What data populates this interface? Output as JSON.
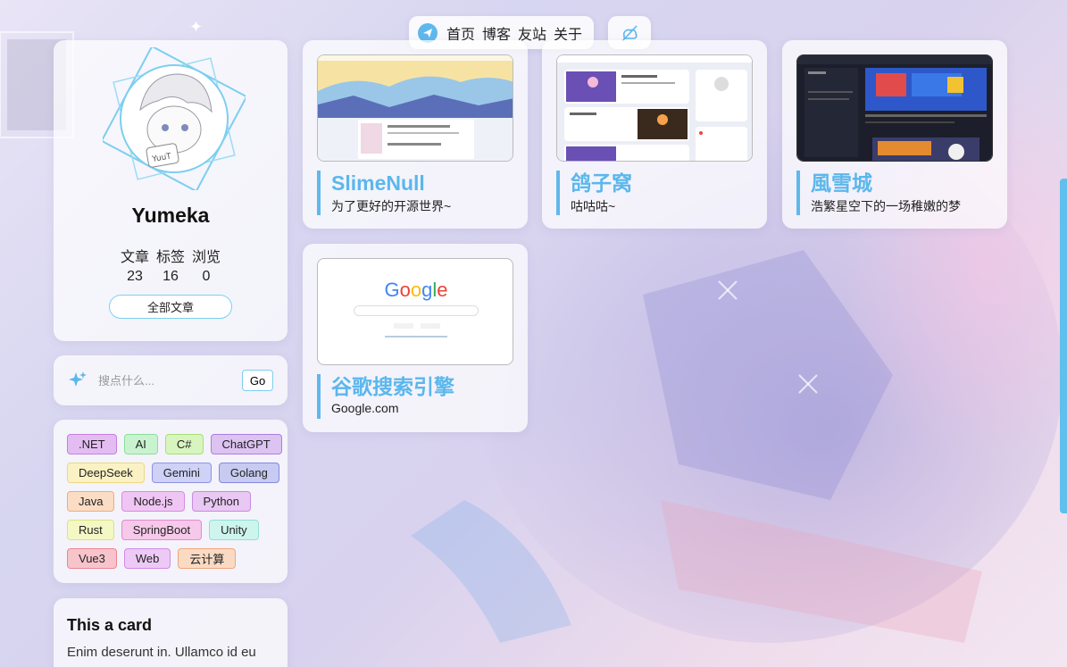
{
  "nav": {
    "links": [
      "首页",
      "博客",
      "友站",
      "关于"
    ]
  },
  "profile": {
    "name": "Yumeka",
    "stats": [
      {
        "label": "文章",
        "value": "23"
      },
      {
        "label": "标签",
        "value": "16"
      },
      {
        "label": "浏览",
        "value": "0"
      }
    ],
    "all_posts_label": "全部文章"
  },
  "search": {
    "placeholder": "搜点什么...",
    "go_label": "Go"
  },
  "tags": [
    [
      {
        "name": ".NET",
        "bg": "#e3bdf2",
        "border": "#c57fe0"
      },
      {
        "name": "AI",
        "bg": "#c9f3cf",
        "border": "#8fdc9c"
      },
      {
        "name": "C#",
        "bg": "#d8f5bf",
        "border": "#a7df7a"
      },
      {
        "name": "ChatGPT",
        "bg": "#dcc3f2",
        "border": "#ad7de0"
      }
    ],
    [
      {
        "name": "DeepSeek",
        "bg": "#fbf2c4",
        "border": "#ecd882"
      },
      {
        "name": "Gemini",
        "bg": "#cfd1f6",
        "border": "#8e93e4"
      },
      {
        "name": "Golang",
        "bg": "#c7caf1",
        "border": "#8389de"
      }
    ],
    [
      {
        "name": "Java",
        "bg": "#fbdcc4",
        "border": "#f0ad7a"
      },
      {
        "name": "Node.js",
        "bg": "#efc6f3",
        "border": "#d98ae2"
      },
      {
        "name": "Python",
        "bg": "#e9c8f3",
        "border": "#c98ae0"
      }
    ],
    [
      {
        "name": "Rust",
        "bg": "#f4f8c4",
        "border": "#dbe281"
      },
      {
        "name": "SpringBoot",
        "bg": "#f6c8ea",
        "border": "#e589cf"
      },
      {
        "name": "Unity",
        "bg": "#cdf5ee",
        "border": "#8ee1d2"
      }
    ],
    [
      {
        "name": "Vue3",
        "bg": "#f8c4cc",
        "border": "#ec8592"
      },
      {
        "name": "Web",
        "bg": "#edc9f5",
        "border": "#d28be6"
      },
      {
        "name": "云计算",
        "bg": "#fbdac4",
        "border": "#f0a679"
      }
    ]
  ],
  "this_card": {
    "title": "This a card",
    "body": "Enim deserunt in. Ullamco id eu"
  },
  "sites": [
    {
      "title": "SlimeNull",
      "desc": "为了更好的开源世界~"
    },
    {
      "title": "鸽子窝",
      "desc": "咕咕咕~"
    },
    {
      "title": "風雪城",
      "desc": "浩繁星空下的一场稚嫩的梦"
    },
    {
      "title": "谷歌搜索引擎",
      "desc": "Google.com"
    }
  ],
  "google_logo": "Google",
  "colors": {
    "accent": "#5bb7ec"
  }
}
